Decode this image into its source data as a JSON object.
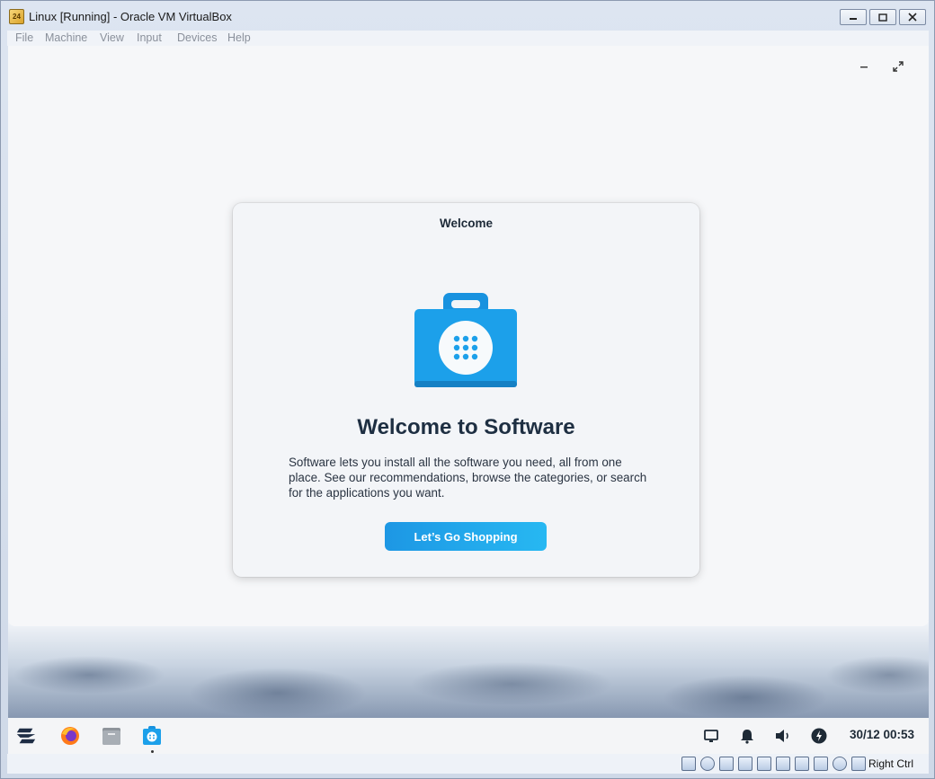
{
  "window": {
    "title": "Linux [Running] - Oracle VM VirtualBox",
    "app_icon_text": "24"
  },
  "menubar": {
    "items": [
      "File",
      "Machine",
      "View",
      "Input",
      "Devices",
      "Help"
    ]
  },
  "dialog": {
    "title": "Welcome",
    "heading": "Welcome to Software",
    "body": "Software lets you install all the software you need, all from one place. See our recommendations, browse the categories, or search for the applications you want.",
    "button": "Let’s Go Shopping"
  },
  "taskbar": {
    "apps": [
      "zorin-menu-icon",
      "firefox-icon",
      "files-icon",
      "software-icon"
    ],
    "tray": [
      "screen-icon",
      "bell-icon",
      "volume-icon",
      "power-icon"
    ],
    "clock": "30/12 00:53"
  },
  "statusbar": {
    "host_key": "Right Ctrl"
  },
  "colors": {
    "accent": "#1d97e4",
    "bag_blue": "#1ca0ea"
  }
}
